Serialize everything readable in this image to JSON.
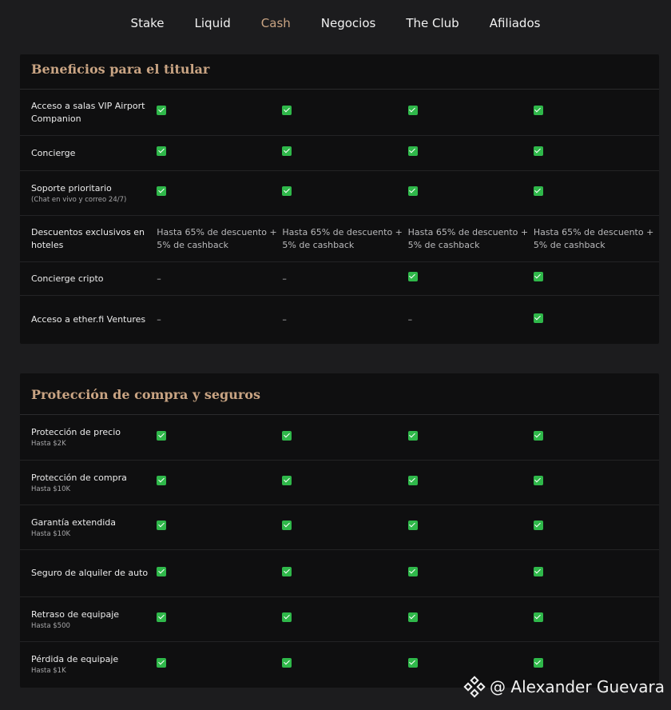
{
  "nav": {
    "items": [
      {
        "label": "Stake",
        "active": false
      },
      {
        "label": "Liquid",
        "active": false
      },
      {
        "label": "Cash",
        "active": true
      },
      {
        "label": "Negocios",
        "active": false
      },
      {
        "label": "The Club",
        "active": false
      },
      {
        "label": "Afiliados",
        "active": false
      }
    ],
    "active_color": "#c9a483"
  },
  "sections": [
    {
      "title": "Beneficios para el titular",
      "rows": [
        {
          "label": "Acceso a salas VIP Airport Companion",
          "sub": "",
          "cells": [
            "check",
            "check",
            "check",
            "check"
          ]
        },
        {
          "label": "Concierge",
          "sub": "",
          "cells": [
            "check",
            "check",
            "check",
            "check"
          ]
        },
        {
          "label": "Soporte prioritario",
          "sub": "(Chat en vivo y correo 24/7)",
          "cells": [
            "check",
            "check",
            "check",
            "check"
          ]
        },
        {
          "label": "Descuentos exclusivos en hoteles",
          "sub": "",
          "cells": [
            "Hasta 65% de descuento + 5% de cashback",
            "Hasta 65% de descuento + 5% de cashback",
            "Hasta 65% de descuento + 5% de cashback",
            "Hasta 65% de descuento + 5% de cashback"
          ]
        },
        {
          "label": "Concierge cripto",
          "sub": "",
          "cells": [
            "–",
            "–",
            "check",
            "check"
          ]
        },
        {
          "label": "Acceso a ether.fi Ventures",
          "sub": "",
          "cells": [
            "–",
            "–",
            "–",
            "check"
          ]
        }
      ]
    },
    {
      "title": "Protección de compra y seguros",
      "rows": [
        {
          "label": "Protección de precio",
          "sub": "Hasta $2K",
          "cells": [
            "check",
            "check",
            "check",
            "check"
          ]
        },
        {
          "label": "Protección de compra",
          "sub": "Hasta $10K",
          "cells": [
            "check",
            "check",
            "check",
            "check"
          ]
        },
        {
          "label": "Garantía extendida",
          "sub": "Hasta $10K",
          "cells": [
            "check",
            "check",
            "check",
            "check"
          ]
        },
        {
          "label": "Seguro de alquiler de auto",
          "sub": "",
          "cells": [
            "check",
            "check",
            "check",
            "check"
          ]
        },
        {
          "label": "Retraso de equipaje",
          "sub": "Hasta $500",
          "cells": [
            "check",
            "check",
            "check",
            "check"
          ]
        },
        {
          "label": "Pérdida de equipaje",
          "sub": "Hasta $1K",
          "cells": [
            "check",
            "check",
            "check",
            "check"
          ]
        }
      ]
    }
  ],
  "watermark": {
    "text": "@ Alexander Guevara",
    "icon": "binance-logo-icon"
  },
  "colors": {
    "background": "#1c1c1e",
    "card": "#0f0f10",
    "accent": "#c9a483",
    "check": "#2fb84a"
  }
}
